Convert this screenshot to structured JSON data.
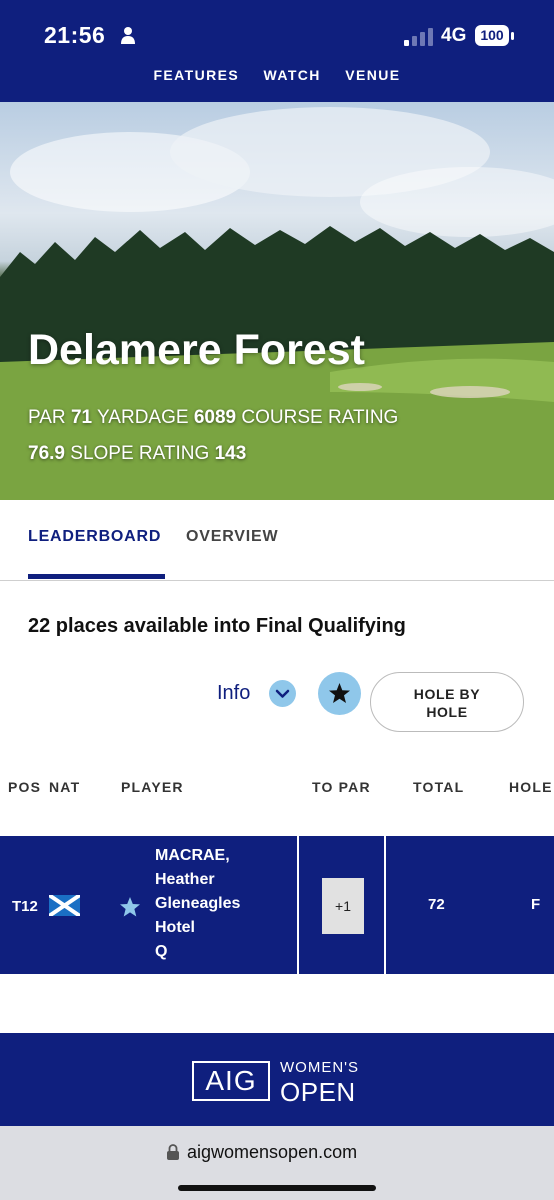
{
  "status": {
    "time": "21:56",
    "network": "4G",
    "battery": "100"
  },
  "nav": {
    "items": [
      "FEATURES",
      "WATCH",
      "VENUE"
    ]
  },
  "hero": {
    "title": "Delamere Forest",
    "par_label": "PAR",
    "par": "71",
    "yardage_label": "YARDAGE",
    "yardage": "6089",
    "course_rating_label": "COURSE RATING",
    "course_rating": "76.9",
    "slope_rating_label": "SLOPE RATING",
    "slope_rating": "143"
  },
  "tabs": {
    "leaderboard": "LEADERBOARD",
    "overview": "OVERVIEW"
  },
  "subtitle": "22 places available into Final Qualifying",
  "controls": {
    "info": "Info",
    "hole_by_hole_line1": "HOLE BY",
    "hole_by_hole_line2": "HOLE"
  },
  "table": {
    "headers": {
      "pos": "POS",
      "nat": "NAT",
      "player": "PLAYER",
      "to_par": "TO PAR",
      "total": "TOTAL",
      "hole": "HOLE"
    },
    "rows": [
      {
        "pos": "T12",
        "name_line1": "MACRAE,",
        "name_line2": "Heather",
        "club_line1": "Gleneagles",
        "club_line2": "Hotel",
        "status": "Q",
        "to_par": "+1",
        "total": "72",
        "hole": "F"
      }
    ]
  },
  "footer": {
    "logo_box": "AIG",
    "logo_line1": "WOMEN'S",
    "logo_line2": "OPEN"
  },
  "browser": {
    "url": "aigwomensopen.com"
  },
  "colors": {
    "navy": "#0f1f7e",
    "light_blue": "#8fc7ea"
  }
}
